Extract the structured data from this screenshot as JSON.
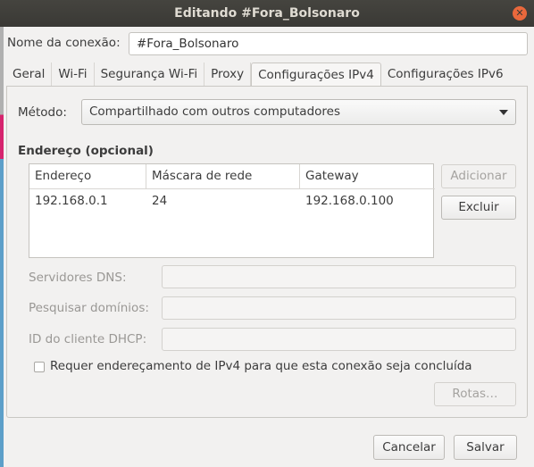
{
  "window": {
    "title": "Editando #Fora_Bolsonaro",
    "close_icon": "close-icon"
  },
  "connection": {
    "label": "Nome da conexão:",
    "value": "#Fora_Bolsonaro"
  },
  "tabs": [
    {
      "label": "Geral"
    },
    {
      "label": "Wi-Fi"
    },
    {
      "label": "Segurança Wi-Fi"
    },
    {
      "label": "Proxy"
    },
    {
      "label": "Configurações IPv4",
      "active": true
    },
    {
      "label": "Configurações IPv6"
    }
  ],
  "ipv4": {
    "method_label": "Método:",
    "method_value": "Compartilhado com outros computadores",
    "address_heading": "Endereço (opcional)",
    "columns": [
      "Endereço",
      "Máscara de rede",
      "Gateway"
    ],
    "rows": [
      [
        "192.168.0.1",
        "24",
        "192.168.0.100"
      ]
    ],
    "add_label": "Adicionar",
    "delete_label": "Excluir",
    "dns_label": "Servidores DNS:",
    "dns_value": "",
    "search_label": "Pesquisar domínios:",
    "search_value": "",
    "dhcp_label": "ID do cliente DHCP:",
    "dhcp_value": "",
    "require_label": "Requer endereçamento de IPv4 para que esta conexão seja concluída",
    "require_checked": false,
    "routes_label": "Rotas…"
  },
  "footer": {
    "cancel_label": "Cancelar",
    "save_label": "Salvar"
  }
}
